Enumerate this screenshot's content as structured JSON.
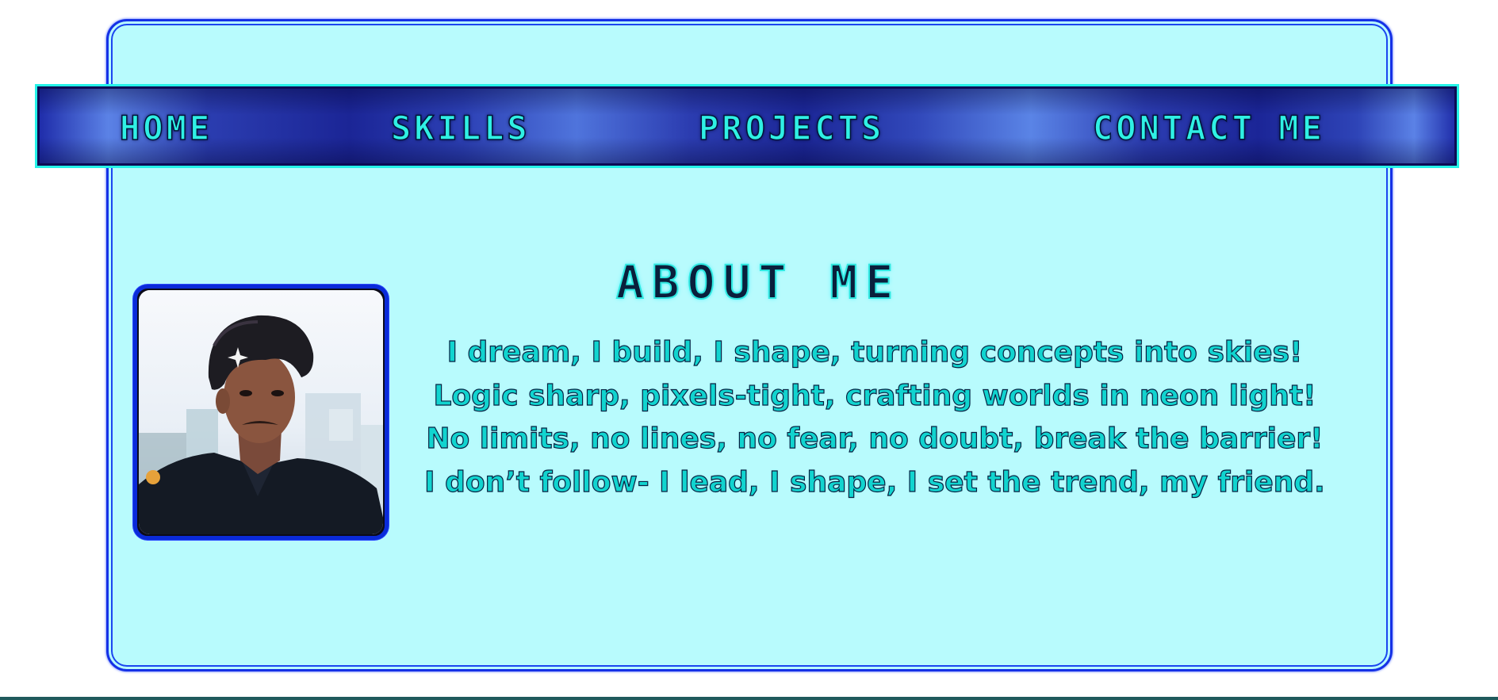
{
  "nav": {
    "items": [
      {
        "label": "HOME"
      },
      {
        "label": "SKILLS"
      },
      {
        "label": "PROJECTS"
      },
      {
        "label": "CONTACT ME"
      }
    ]
  },
  "about": {
    "title": "ABOUT ME",
    "lines": [
      "I dream, I build, I shape, turning concepts into skies!",
      "Logic sharp, pixels-tight, crafting worlds in neon light!",
      "No limits, no lines, no fear, no doubt, break the barrier!",
      "I don’t follow- I lead, I shape, I set the trend, my friend."
    ]
  },
  "colors": {
    "accent_cyan": "#2ff0e4",
    "panel_bg": "#b8fbfd",
    "border_blue": "#1531e6",
    "nav_blue": "#1d2aa8"
  }
}
